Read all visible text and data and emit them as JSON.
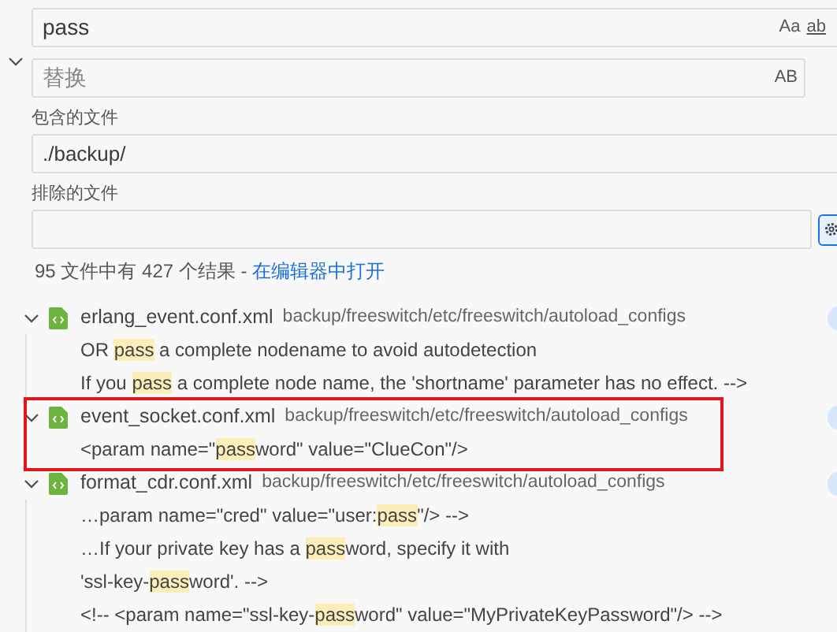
{
  "search": {
    "value": "pass",
    "options": [
      "Aa",
      "ab"
    ]
  },
  "replace": {
    "placeholder": "替换",
    "options": [
      "AB"
    ]
  },
  "include": {
    "label": "包含的文件",
    "value": "./backup/"
  },
  "exclude": {
    "label": "排除的文件"
  },
  "summary": {
    "text": "95 文件中有 427 个结果 - ",
    "link": "在编辑器中打开"
  },
  "results": [
    {
      "file": "erlang_event.conf.xml",
      "path": "backup/freeswitch/etc/freeswitch/autoload_configs",
      "expanded": true,
      "annotated": false,
      "lines": [
        [
          {
            "text": "OR "
          },
          {
            "text": "pass",
            "match": true
          },
          {
            "text": " a complete nodename to avoid autodetection"
          }
        ],
        [
          {
            "text": "If you "
          },
          {
            "text": "pass",
            "match": true
          },
          {
            "text": " a complete node name, the 'shortname' parameter has no effect. -->"
          }
        ]
      ]
    },
    {
      "file": "event_socket.conf.xml",
      "path": "backup/freeswitch/etc/freeswitch/autoload_configs",
      "expanded": true,
      "annotated": true,
      "lines": [
        [
          {
            "text": "<param name=\""
          },
          {
            "text": "pass",
            "match": true
          },
          {
            "text": "word\" value=\"ClueCon\"/>"
          }
        ]
      ]
    },
    {
      "file": "format_cdr.conf.xml",
      "path": "backup/freeswitch/etc/freeswitch/autoload_configs",
      "expanded": true,
      "annotated": false,
      "lines": [
        [
          {
            "text": "…param name=\"cred\" value=\"user:"
          },
          {
            "text": "pass",
            "match": true
          },
          {
            "text": "\"/> -->"
          }
        ],
        [
          {
            "text": "…If your private key has a "
          },
          {
            "text": "pass",
            "match": true
          },
          {
            "text": "word, specify it with"
          }
        ],
        [
          {
            "text": "'ssl-key-"
          },
          {
            "text": "pass",
            "match": true
          },
          {
            "text": "word'. -->"
          }
        ],
        [
          {
            "text": "<!-- <param name=\"ssl-key-"
          },
          {
            "text": "pass",
            "match": true
          },
          {
            "text": "word\" value=\"MyPrivateKeyPassword\"/> -->"
          }
        ]
      ]
    }
  ]
}
